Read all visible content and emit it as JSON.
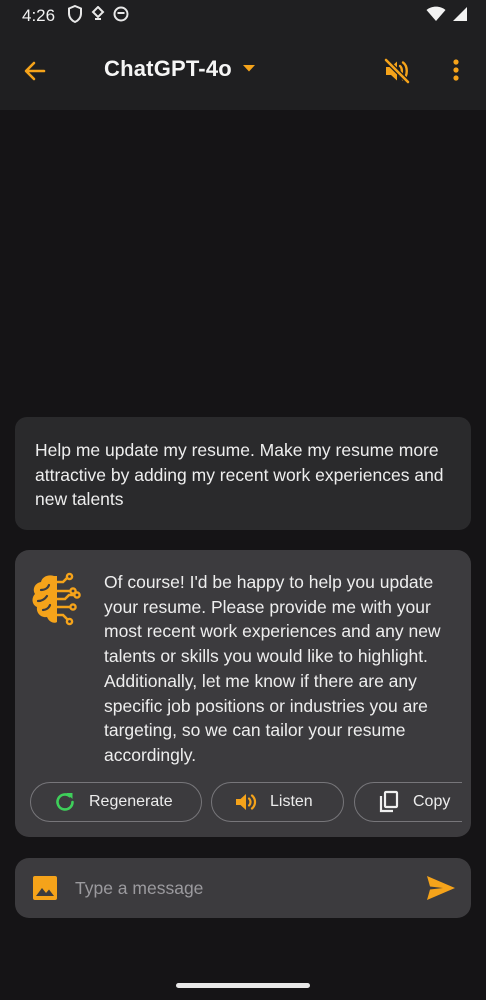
{
  "status_bar": {
    "time": "4:26",
    "icons": [
      "shield-icon",
      "vpn-key-icon",
      "circle-app-icon",
      "wifi-icon",
      "cellular-signal-icon"
    ]
  },
  "app_bar": {
    "title": "ChatGPT-4o",
    "back_icon": "arrow-back-icon",
    "dropdown_icon": "caret-down-icon",
    "mute_icon": "volume-off-icon",
    "more_icon": "more-vertical-icon"
  },
  "messages": [
    {
      "role": "user",
      "text": "Help me update my resume. Make my resume more attractive by adding my recent work experiences and new talents"
    },
    {
      "role": "assistant",
      "avatar_icon": "brain-circuit-icon",
      "text": "Of course! I'd be happy to help you update your resume. Please provide me with your most recent work experiences and any new talents or skills you would like to highlight. Additionally, let me know if there are any specific job positions or industries you are targeting, so we can tailor your resume accordingly.",
      "actions": {
        "regenerate": "Regenerate",
        "listen": "Listen",
        "copy": "Copy"
      }
    }
  ],
  "composer": {
    "placeholder": "Type a message",
    "image_icon": "image-icon",
    "send_icon": "send-icon"
  },
  "colors": {
    "accent": "#f5a31a",
    "regenerate_green": "#3ecf5a",
    "background": "#151416",
    "app_bar": "#1f1f21",
    "card": "#3c3b3e",
    "user_bubble": "#2a2a2c"
  }
}
